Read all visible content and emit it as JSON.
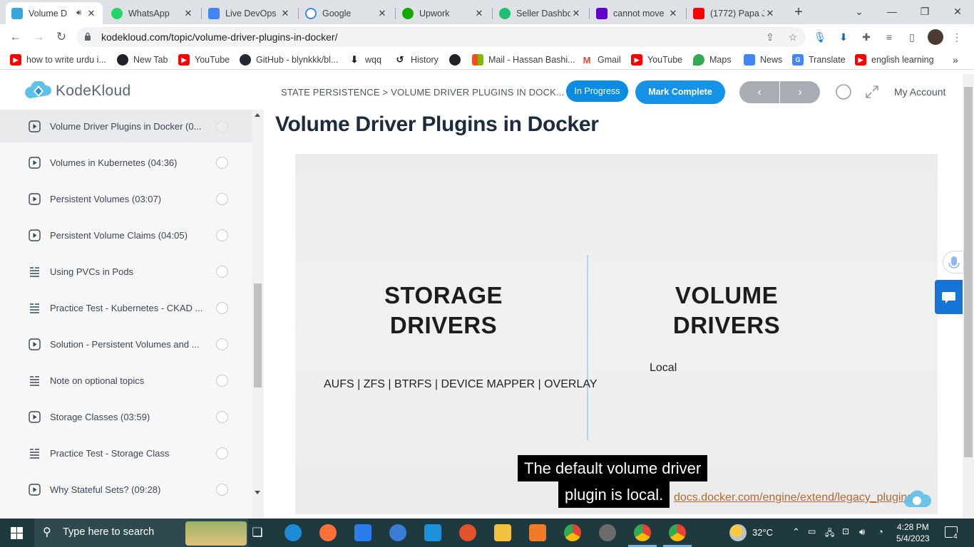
{
  "browser": {
    "tabs": [
      {
        "label": "Volume D",
        "icon": "kodekloud-favicon",
        "active": true
      },
      {
        "label": "WhatsApp",
        "icon": "whatsapp-favicon"
      },
      {
        "label": "Live DevOps |",
        "icon": "google-docs-favicon"
      },
      {
        "label": "Google",
        "icon": "google-favicon"
      },
      {
        "label": "Upwork",
        "icon": "upwork-favicon"
      },
      {
        "label": "Seller Dashbo",
        "icon": "fiverr-favicon"
      },
      {
        "label": "cannot move",
        "icon": "yahoo-favicon"
      },
      {
        "label": "(1772) Papa J",
        "icon": "youtube-favicon"
      }
    ],
    "url": "kodekloud.com/topic/volume-driver-plugins-in-docker/",
    "bookmarks": [
      {
        "label": "how to write urdu i...",
        "icon": "youtube-icon"
      },
      {
        "label": "New Tab",
        "icon": "globe-icon"
      },
      {
        "label": "YouTube",
        "icon": "youtube-icon"
      },
      {
        "label": "GitHub - blynkkk/bl...",
        "icon": "github-icon"
      },
      {
        "label": "wqq",
        "icon": "download-icon"
      },
      {
        "label": "History",
        "icon": "history-icon"
      },
      {
        "label": "",
        "icon": "globe-icon"
      },
      {
        "label": "Mail - Hassan Bashi...",
        "icon": "microsoft-icon"
      },
      {
        "label": "Gmail",
        "icon": "gmail-icon"
      },
      {
        "label": "YouTube",
        "icon": "youtube-icon"
      },
      {
        "label": "Maps",
        "icon": "maps-icon"
      },
      {
        "label": "News",
        "icon": "news-icon"
      },
      {
        "label": "Translate",
        "icon": "translate-icon"
      },
      {
        "label": "english learning",
        "icon": "youtube-icon"
      }
    ]
  },
  "header": {
    "logo_text": "KodeKloud",
    "breadcrumb": "STATE PERSISTENCE > VOLUME DRIVER PLUGINS IN DOCK...",
    "status_label": "In Progress",
    "complete_label": "Mark Complete",
    "prev_label": "‹",
    "next_label": "›",
    "account_label": "My Account"
  },
  "sidebar": {
    "items": [
      {
        "label": "Volume Driver Plugins in Docker (0...",
        "type": "video",
        "current": true
      },
      {
        "label": "Volumes in Kubernetes (04:36)",
        "type": "video"
      },
      {
        "label": "Persistent Volumes (03:07)",
        "type": "video"
      },
      {
        "label": "Persistent Volume Claims (04:05)",
        "type": "video"
      },
      {
        "label": "Using PVCs in Pods",
        "type": "text"
      },
      {
        "label": "Practice Test - Kubernetes - CKAD ...",
        "type": "text"
      },
      {
        "label": "Solution - Persistent Volumes and ...",
        "type": "video"
      },
      {
        "label": "Note on optional topics",
        "type": "text"
      },
      {
        "label": "Storage Classes (03:59)",
        "type": "video"
      },
      {
        "label": "Practice Test - Storage Class",
        "type": "text"
      },
      {
        "label": "Why Stateful Sets? (09:28)",
        "type": "video"
      }
    ]
  },
  "main": {
    "title": "Volume Driver Plugins in Docker",
    "slide": {
      "left_heading_1": "STORAGE",
      "left_heading_2": "DRIVERS",
      "left_text": "AUFS | ZFS | BTRFS | DEVICE MAPPER | OVERLAY",
      "right_heading_1": "VOLUME",
      "right_heading_2": "DRIVERS",
      "right_text": "Local",
      "link": "docs.docker.com/engine/extend/legacy_plugins/"
    },
    "caption_line_1": "The default volume driver",
    "caption_line_2": "plugin is local."
  },
  "taskbar": {
    "search_placeholder": "Type here to search",
    "temperature": "32°C",
    "time": "4:28 PM",
    "date": "5/4/2023",
    "notification_count": "4"
  },
  "colors": {
    "brand_blue": "#1693e6",
    "title_navy": "#1d2b3e",
    "link_orange": "#b06a37"
  }
}
